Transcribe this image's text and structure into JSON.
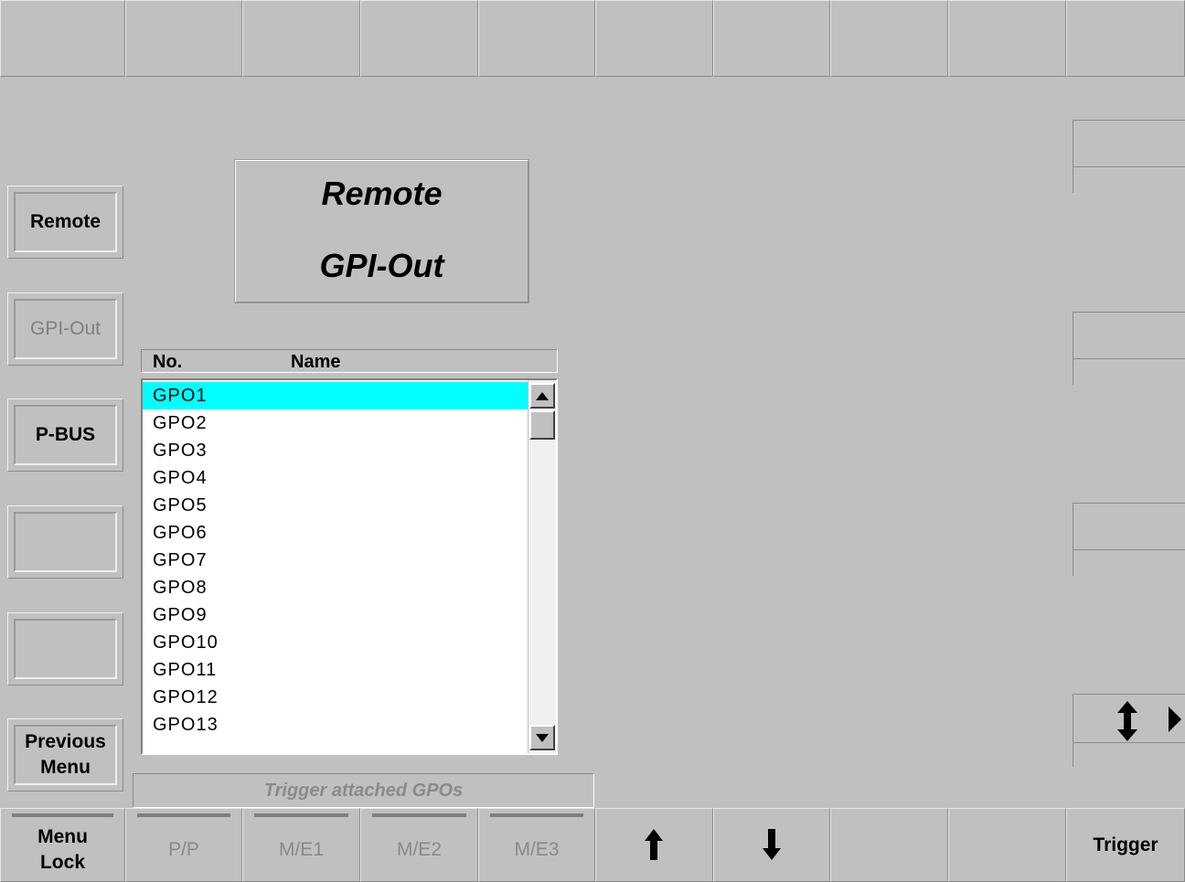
{
  "top_bar": {
    "cells": [
      "",
      "",
      "",
      "",
      "",
      "",
      "",
      "",
      "",
      ""
    ]
  },
  "header": {
    "title_line1": "Remote",
    "title_line2": "GPI-Out"
  },
  "side_menu": {
    "items": [
      {
        "label": "Remote",
        "enabled": true
      },
      {
        "label": "GPI-Out",
        "enabled": false
      },
      {
        "label": "P-BUS",
        "enabled": true
      },
      {
        "label": "",
        "enabled": true
      },
      {
        "label": "",
        "enabled": true
      },
      {
        "label": "Previous Menu",
        "enabled": true
      }
    ]
  },
  "gpo_list": {
    "columns": [
      "No.",
      "Name"
    ],
    "selected_index": 0,
    "rows": [
      "GPO1",
      "GPO2",
      "GPO3",
      "GPO4",
      "GPO5",
      "GPO6",
      "GPO7",
      "GPO8",
      "GPO9",
      "GPO10",
      "GPO11",
      "GPO12",
      "GPO13"
    ]
  },
  "status": {
    "text": "Trigger attached GPOs"
  },
  "right_panel": {
    "adjust_icon": "up-down-arrow-icon",
    "expand_icon": "triangle-right-icon"
  },
  "bottom_bar": {
    "menu_lock": "Menu Lock",
    "pp": "P/P",
    "me1": "M/E1",
    "me2": "M/E2",
    "me3": "M/E3",
    "up_icon": "arrow-up-icon",
    "down_icon": "arrow-down-icon",
    "trigger": "Trigger"
  },
  "colors": {
    "background": "#c0c0c0",
    "selection": "#00ffff",
    "disabled_text": "#8a8a8a"
  }
}
